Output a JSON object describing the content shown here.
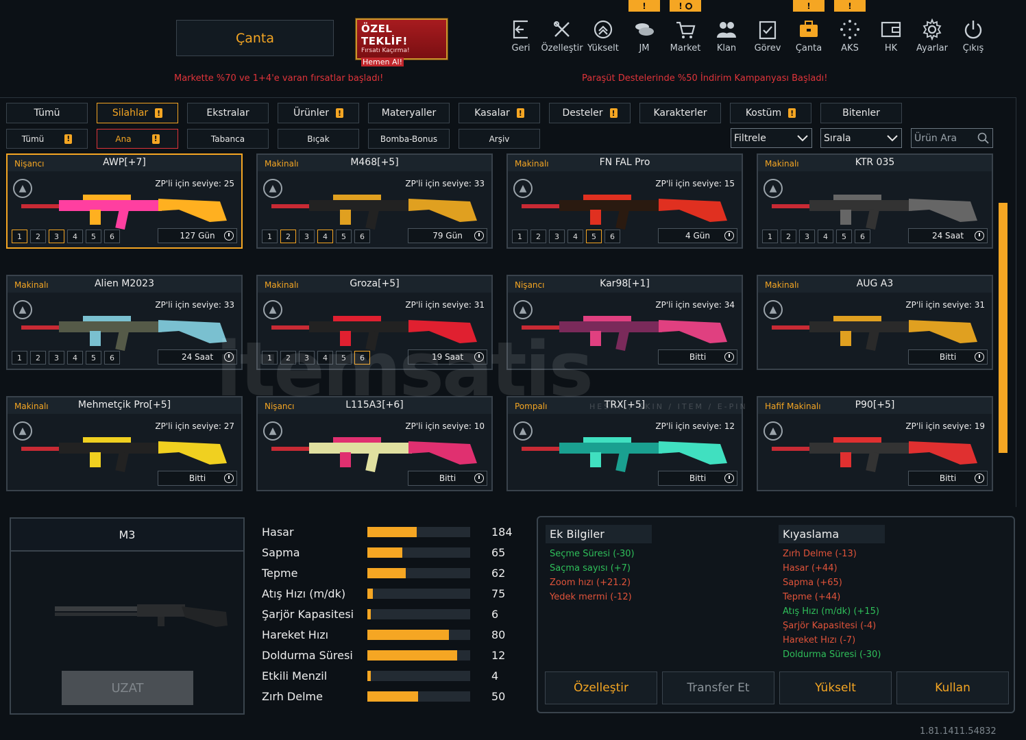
{
  "header": {
    "title": "Çanta",
    "offer": {
      "line1": "ÖZEL TEKLİF!",
      "line2": "Fırsatı Kaçırma!",
      "line3": "Hemen Al!"
    },
    "nav": [
      {
        "label": "Geri",
        "icon": "back-icon"
      },
      {
        "label": "Özelleştir",
        "icon": "customize-icon"
      },
      {
        "label": "Yükselt",
        "icon": "upgrade-icon"
      },
      {
        "label": "JM",
        "icon": "coins-icon"
      },
      {
        "label": "Market",
        "icon": "cart-icon"
      },
      {
        "label": "Klan",
        "icon": "clan-icon"
      },
      {
        "label": "Görev",
        "icon": "task-icon"
      },
      {
        "label": "Çanta",
        "icon": "bag-icon"
      },
      {
        "label": "AKS",
        "icon": "aks-icon"
      },
      {
        "label": "HK",
        "icon": "wallet-icon"
      },
      {
        "label": "Ayarlar",
        "icon": "gear-icon"
      },
      {
        "label": "Çıkış",
        "icon": "power-icon"
      }
    ],
    "badges": {
      "jm": "!",
      "market": "!",
      "canta": "!",
      "aks": "!"
    }
  },
  "tickers": {
    "left": "Markette %70 ve 1+4'e varan fırsatlar başladı!",
    "right": "Paraşüt Destelerinde %50 İndirim Kampanyası Başladı!"
  },
  "tabs": [
    {
      "label": "Tümü",
      "alert": false
    },
    {
      "label": "Silahlar",
      "alert": true
    },
    {
      "label": "Ekstralar",
      "alert": false
    },
    {
      "label": "Ürünler",
      "alert": true
    },
    {
      "label": "Materyaller",
      "alert": false
    },
    {
      "label": "Kasalar",
      "alert": true
    },
    {
      "label": "Desteler",
      "alert": true
    },
    {
      "label": "Karakterler",
      "alert": false
    },
    {
      "label": "Kostüm",
      "alert": true
    },
    {
      "label": "Bitenler",
      "alert": false
    }
  ],
  "subtabs": [
    {
      "label": "Tümü",
      "alert": true
    },
    {
      "label": "Ana",
      "alert": true
    },
    {
      "label": "Tabanca",
      "alert": false
    },
    {
      "label": "Bıçak",
      "alert": false
    },
    {
      "label": "Bomba-Bonus",
      "alert": false
    },
    {
      "label": "Arşiv",
      "alert": false
    }
  ],
  "filters": {
    "filter": "Filtrele",
    "sort": "Sırala",
    "search_placeholder": "Ürün Ara"
  },
  "weapons": [
    {
      "class": "Nişancı",
      "name": "AWP[+7]",
      "req": "ZP'li için seviye: 25",
      "time": "127 Gün",
      "levels_on": [
        1,
        3
      ],
      "levels": 6,
      "selected": true,
      "colors": [
        "#ff3fa0",
        "#ffb020"
      ]
    },
    {
      "class": "Makinalı",
      "name": "M468[+5]",
      "req": "ZP'li için seviye: 33",
      "time": "79 Gün",
      "levels_on": [
        2,
        4
      ],
      "levels": 6,
      "colors": [
        "#222",
        "#e0a020"
      ]
    },
    {
      "class": "Makinalı",
      "name": "FN FAL Pro",
      "req": "ZP'li için seviye: 15",
      "time": "4 Gün",
      "levels_on": [
        5
      ],
      "levels": 6,
      "colors": [
        "#2a1a10",
        "#e03020"
      ]
    },
    {
      "class": "Makinalı",
      "name": "KTR 035",
      "req": "",
      "time": "24 Saat",
      "levels_on": [],
      "levels": 6,
      "colors": [
        "#333",
        "#666"
      ]
    },
    {
      "class": "Makinalı",
      "name": "Alien M2023",
      "req": "ZP'li için seviye: 33",
      "time": "24 Saat",
      "levels_on": [],
      "levels": 6,
      "colors": [
        "#555a48",
        "#7ac0d0"
      ]
    },
    {
      "class": "Makinalı",
      "name": "Groza[+5]",
      "req": "ZP'li için seviye: 31",
      "time": "19 Saat",
      "levels_on": [
        6
      ],
      "levels": 6,
      "colors": [
        "#222",
        "#e02030"
      ]
    },
    {
      "class": "Nişancı",
      "name": "Kar98[+1]",
      "req": "ZP'li için seviye: 34",
      "time": "Bitti",
      "levels_on": [],
      "levels": 0,
      "colors": [
        "#7a2a5a",
        "#e04080"
      ]
    },
    {
      "class": "Makinalı",
      "name": "AUG A3",
      "req": "ZP'li için seviye: 31",
      "time": "Bitti",
      "levels_on": [],
      "levels": 0,
      "colors": [
        "#2a2a2a",
        "#e0a020"
      ]
    },
    {
      "class": "Makinalı",
      "name": "Mehmetçik Pro[+5]",
      "req": "ZP'li için seviye: 27",
      "time": "Bitti",
      "levels_on": [],
      "levels": 0,
      "colors": [
        "#222",
        "#f0d020"
      ]
    },
    {
      "class": "Nişancı",
      "name": "L115A3[+6]",
      "req": "ZP'li için seviye: 10",
      "time": "Bitti",
      "levels_on": [],
      "levels": 0,
      "colors": [
        "#e0e0a0",
        "#e03070"
      ]
    },
    {
      "class": "Pompalı",
      "name": "TRX[+5]",
      "req": "ZP'li için seviye: 12",
      "time": "Bitti",
      "levels_on": [],
      "levels": 0,
      "colors": [
        "#1aa090",
        "#40e0c0"
      ]
    },
    {
      "class": "Hafif Makinalı",
      "name": "P90[+5]",
      "req": "ZP'li için seviye: 19",
      "time": "Bitti",
      "levels_on": [],
      "levels": 0,
      "colors": [
        "#333",
        "#e03030"
      ]
    }
  ],
  "watermark": {
    "main": "itemsatis",
    "sub": "HESAP / SKIN / ITEM / E-PIN"
  },
  "preview": {
    "name": "M3",
    "extend_button": "UZAT"
  },
  "stats": [
    {
      "label": "Hasar",
      "value": "184",
      "fill": 0.48
    },
    {
      "label": "Sapma",
      "value": "65",
      "fill": 0.34
    },
    {
      "label": "Tepme",
      "value": "62",
      "fill": 0.37
    },
    {
      "label": "Atış Hızı (m/dk)",
      "value": "75",
      "fill": 0.05
    },
    {
      "label": "Şarjör Kapasitesi",
      "value": "6",
      "fill": 0.03
    },
    {
      "label": "Hareket Hızı",
      "value": "80",
      "fill": 0.79
    },
    {
      "label": "Doldurma Süresi",
      "value": "12",
      "fill": 0.87
    },
    {
      "label": "Etkili Menzil",
      "value": "4",
      "fill": 0.03
    },
    {
      "label": "Zırh Delme",
      "value": "50",
      "fill": 0.49
    }
  ],
  "extra_info": {
    "title": "Ek Bilgiler",
    "lines": [
      {
        "text": "Seçme Süresi (-30)",
        "tone": "green"
      },
      {
        "text": "Saçma sayısı (+7)",
        "tone": "green"
      },
      {
        "text": "Zoom hızı (+21.2)",
        "tone": "red"
      },
      {
        "text": "Yedek mermi (-12)",
        "tone": "red"
      }
    ]
  },
  "comparison": {
    "title": "Kıyaslama",
    "lines": [
      {
        "text": "Zırh Delme (-13)",
        "tone": "red"
      },
      {
        "text": "Hasar (+44)",
        "tone": "red"
      },
      {
        "text": "Sapma (+65)",
        "tone": "red"
      },
      {
        "text": "Tepme (+44)",
        "tone": "red"
      },
      {
        "text": "Atış Hızı (m/dk) (+15)",
        "tone": "green"
      },
      {
        "text": "Şarjör Kapasitesi (-4)",
        "tone": "red"
      },
      {
        "text": "Hareket Hızı (-7)",
        "tone": "red"
      },
      {
        "text": "Doldurma Süresi (-30)",
        "tone": "green"
      }
    ]
  },
  "actions": [
    {
      "label": "Özelleştir",
      "enabled": true
    },
    {
      "label": "Transfer Et",
      "enabled": false
    },
    {
      "label": "Yükselt",
      "enabled": true
    },
    {
      "label": "Kullan",
      "enabled": true
    }
  ],
  "version": "1.81.1411.54832",
  "colors": {
    "accent": "#f5a623",
    "alert_red": "#e0343a",
    "positive": "#2fbf5a",
    "negative": "#e0533a"
  }
}
